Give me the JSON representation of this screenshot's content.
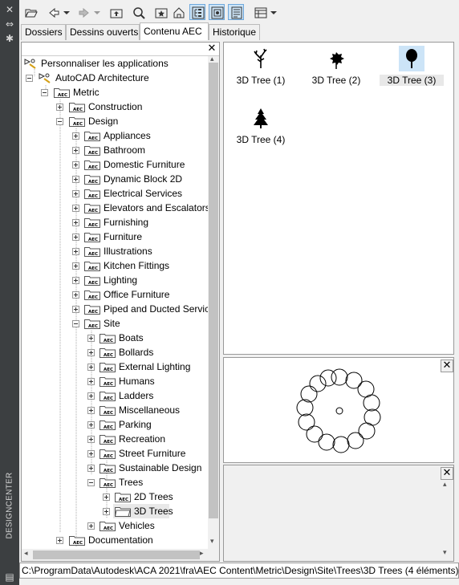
{
  "app": {
    "side_title": "DESIGNCENTER"
  },
  "toolbar": {
    "buttons": [
      "open-icon",
      "back-icon",
      "back-dropdown-icon",
      "forward-icon",
      "forward-dropdown-icon",
      "up-icon",
      "search-icon",
      "favorites-icon",
      "home-icon",
      "tree-toggle-icon",
      "preview-icon",
      "description-icon",
      "views-icon",
      "views-dropdown-icon"
    ]
  },
  "tabs": [
    {
      "label": "Dossiers"
    },
    {
      "label": "Dessins ouverts"
    },
    {
      "label": "Contenu AEC"
    },
    {
      "label": "Historique"
    }
  ],
  "active_tab": "Contenu AEC",
  "tree": {
    "root": "Personnaliser les applications",
    "app": "AutoCAD Architecture",
    "metric": "Metric",
    "construction": "Construction",
    "design": "Design",
    "design_children": [
      "Appliances",
      "Bathroom",
      "Domestic Furniture",
      "Dynamic Block 2D",
      "Electrical Services",
      "Elevators and Escalators",
      "Furnishing",
      "Furniture",
      "Illustrations",
      "Kitchen Fittings",
      "Lighting",
      "Office Furniture",
      "Piped and Ducted Service"
    ],
    "site": "Site",
    "site_children": [
      "Boats",
      "Bollards",
      "External Lighting",
      "Humans",
      "Ladders",
      "Miscellaneous",
      "Parking",
      "Recreation",
      "Street Furniture",
      "Sustainable Design"
    ],
    "trees": "Trees",
    "trees_children": [
      "2D Trees",
      "3D Trees"
    ],
    "vehicles": "Vehicles",
    "documentation": "Documentation",
    "selected": "3D Trees"
  },
  "content_items": [
    {
      "label": "3D Tree (1)",
      "icon": "tree-bare-icon",
      "selected": false
    },
    {
      "label": "3D Tree (2)",
      "icon": "tree-leafy-icon",
      "selected": false
    },
    {
      "label": "3D Tree (3)",
      "icon": "tree-round-icon",
      "selected": true
    },
    {
      "label": "3D Tree (4)",
      "icon": "tree-conifer-icon",
      "selected": false
    }
  ],
  "status": {
    "path": "C:\\ProgramData\\Autodesk\\ACA 2021\\fra\\AEC Content\\Metric\\Design\\Site\\Trees\\3D Trees (4 éléments)"
  },
  "colors": {
    "selection": "#cce4f7",
    "strip": "#3c3f41"
  }
}
